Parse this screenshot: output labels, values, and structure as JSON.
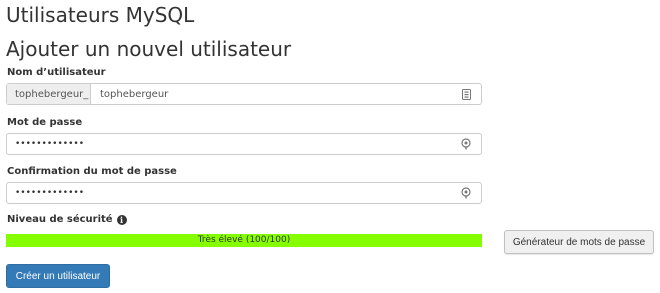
{
  "page": {
    "title": "Utilisateurs MySQL",
    "section_title": "Ajouter un nouvel utilisateur"
  },
  "username": {
    "label": "Nom d’utilisateur",
    "prefix": "tophebergeur_",
    "value": "tophebergeur",
    "icon": "id-card-icon"
  },
  "password": {
    "label": "Mot de passe",
    "value": "•••••••••••••",
    "icon": "key-icon"
  },
  "password_confirm": {
    "label": "Confirmation du mot de passe",
    "value": "•••••••••••••",
    "icon": "key-icon"
  },
  "strength": {
    "label": "Niveau de sécurité",
    "icon": "info-icon",
    "text": "Très élevé (100/100)",
    "score": 100,
    "max": 100,
    "color": "#85ff00"
  },
  "actions": {
    "generator_label": "Générateur de mots de passe",
    "create_label": "Créer un utilisateur",
    "create_color": "#337ab7"
  }
}
